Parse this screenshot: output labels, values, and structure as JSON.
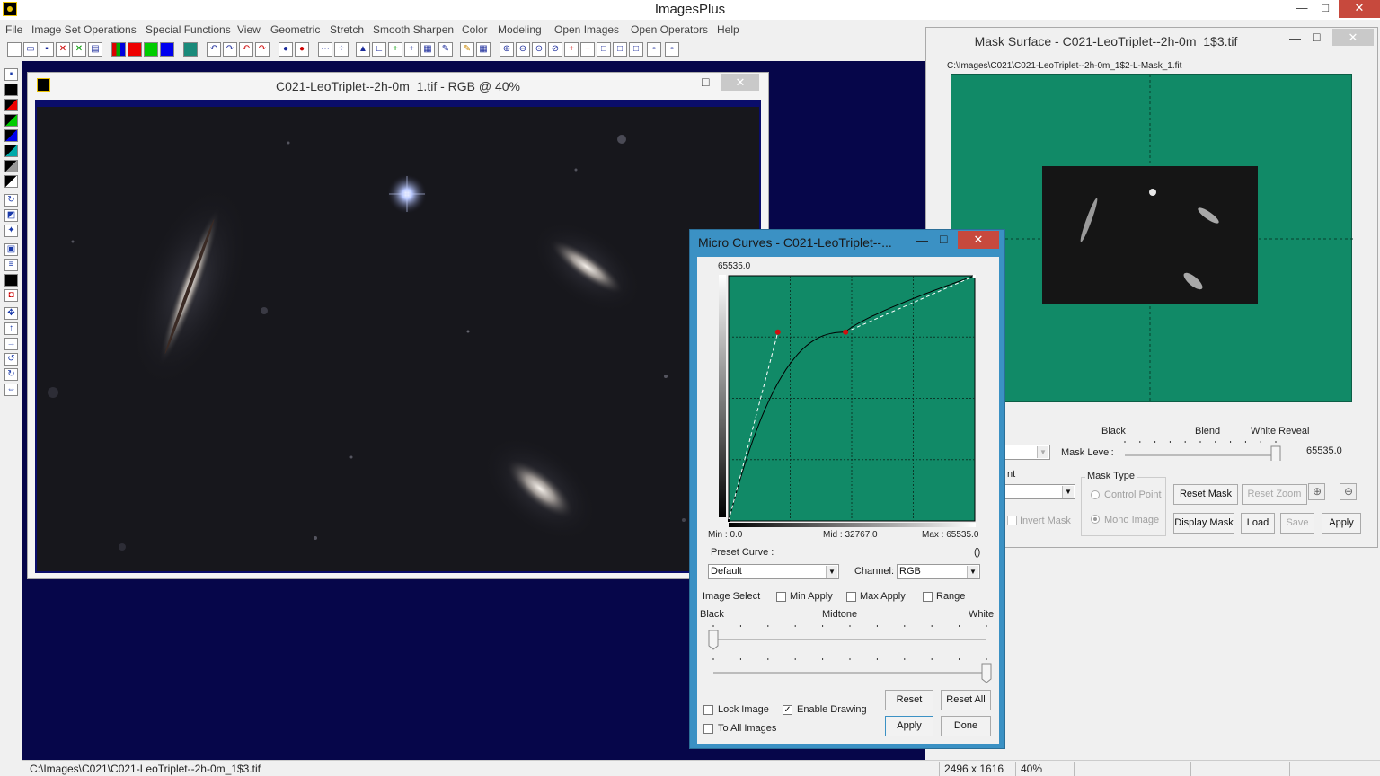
{
  "app": {
    "title": "ImagesPlus"
  },
  "menu": [
    "File",
    "Image Set Operations",
    "Special Functions",
    "View",
    "Geometric",
    "Stretch",
    "Smooth Sharpen",
    "Color",
    "Modeling",
    "Open Images",
    "Open Operators",
    "Help"
  ],
  "image_window": {
    "title": "C021-LeoTriplet--2h-0m_1.tif - RGB @ 40%"
  },
  "mask_window": {
    "title": "Mask Surface - C021-LeoTriplet--2h-0m_1$3.tif",
    "path": "C:\\Images\\C021\\C021-LeoTriplet--2h-0m_1$2-L-Mask_1.fit",
    "slider_labels": {
      "black": "Black",
      "blend": "Blend",
      "white_reveal": "White Reveal"
    },
    "mask_level_label": "Mask Level:",
    "mask_level_value": "65535.0",
    "mask_level_fraction": 1.0,
    "partial_label": "nt",
    "invert_mask": "Invert Mask",
    "mask_type_label": "Mask Type",
    "control_point": "Control Point",
    "mono_image": "Mono Image",
    "buttons": {
      "reset_mask": "Reset Mask",
      "reset_zoom": "Reset Zoom",
      "display_mask": "Display Mask",
      "load": "Load",
      "save": "Save",
      "apply": "Apply"
    }
  },
  "micro_curves": {
    "title": "Micro Curves - C021-LeoTriplet--...",
    "y_max_label": "65535.0",
    "min_label": "Min :  0.0",
    "mid_label": "Mid : 32767.0",
    "max_label": "Max : 65535.0",
    "preset_curve_label": "Preset Curve :",
    "preset_value_hint": "()",
    "preset_value": "Default",
    "channel_label": "Channel:",
    "channel_value": "RGB",
    "image_select": "Image Select",
    "min_apply": "Min Apply",
    "max_apply": "Max Apply",
    "range": "Range",
    "black": "Black",
    "midtone": "Midtone",
    "white": "White",
    "slider1_fraction": 0.0,
    "slider2_fraction": 1.0,
    "lock_image": "Lock Image",
    "enable_drawing": "Enable Drawing",
    "enable_drawing_checked": true,
    "to_all_images": "To All Images",
    "buttons": {
      "reset": "Reset",
      "reset_all": "Reset All",
      "apply": "Apply",
      "done": "Done"
    },
    "control_points": [
      [
        0,
        0
      ],
      [
        0.2,
        0.77
      ],
      [
        0.475,
        0.77
      ],
      [
        1,
        1
      ]
    ]
  },
  "status": {
    "path": "C:\\Images\\C021\\C021-LeoTriplet--2h-0m_1$3.tif",
    "dimensions": "2496 x 1616",
    "zoom": "40%"
  },
  "colors": {
    "workspace": "#06064a",
    "curve_bg": "#118a67",
    "dialog_frame": "#3b91c4",
    "close_button": "#c7493d"
  }
}
